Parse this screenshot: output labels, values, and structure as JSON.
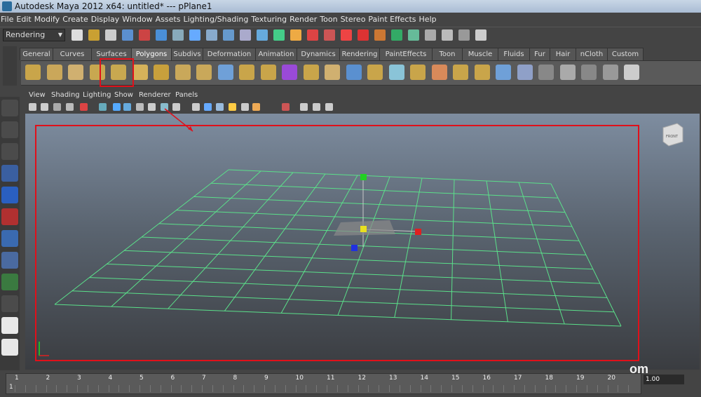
{
  "window": {
    "title": "Autodesk Maya 2012 x64: untitled*   ---   pPlane1"
  },
  "menu": [
    "File",
    "Edit",
    "Modify",
    "Create",
    "Display",
    "Window",
    "Assets",
    "Lighting/Shading",
    "Texturing",
    "Render",
    "Toon",
    "Stereo",
    "Paint Effects",
    "Help"
  ],
  "status": {
    "mode": "Rendering"
  },
  "shelf_tabs": [
    "General",
    "Curves",
    "Surfaces",
    "Polygons",
    "Subdivs",
    "Deformation",
    "Animation",
    "Dynamics",
    "Rendering",
    "PaintEffects",
    "Toon",
    "Muscle",
    "Fluids",
    "Fur",
    "Hair",
    "nCloth",
    "Custom"
  ],
  "active_tab": "Polygons",
  "panel_menu": [
    "View",
    "Shading",
    "Lighting",
    "Show",
    "Renderer",
    "Panels"
  ],
  "viewcube": {
    "label": "FRONT"
  },
  "timeline": {
    "ticks": [
      "1",
      "2",
      "3",
      "4",
      "5",
      "6",
      "7",
      "8",
      "9",
      "10",
      "11",
      "12",
      "13",
      "14",
      "15",
      "16",
      "17",
      "18",
      "19",
      "20"
    ],
    "left_field": "1",
    "time_value": "1.00"
  },
  "watermark": "om",
  "colors": {
    "highlight": "#e0101a",
    "grid": "#5be08a"
  }
}
